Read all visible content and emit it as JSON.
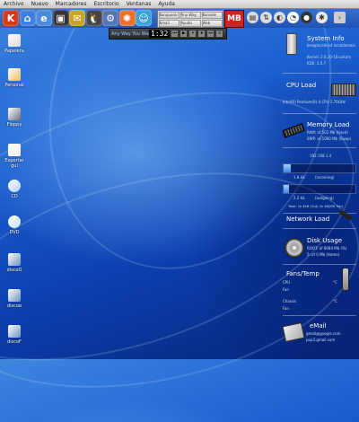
{
  "menubar": {
    "items": [
      "Archivo",
      "Nuevo",
      "Marcadores",
      "Escritorio",
      "Ventanas",
      "Ayuda"
    ]
  },
  "panel": {
    "launchers": [
      {
        "icon": "k-icon",
        "glyph": "K",
        "color": "#d23a1e"
      },
      {
        "icon": "home-icon",
        "glyph": "⌂",
        "color": "#3f7fe0"
      },
      {
        "icon": "konqueror-icon",
        "glyph": "e",
        "color": "#4a8ad8"
      },
      {
        "icon": "terminal-icon",
        "glyph": "▣",
        "color": "#333333"
      },
      {
        "icon": "mail-icon",
        "glyph": "✉",
        "color": "#c9a227"
      },
      {
        "icon": "tux-icon",
        "glyph": "🐧",
        "color": "#444444"
      },
      {
        "icon": "settings-icon",
        "glyph": "⚙",
        "color": "#5573b8"
      },
      {
        "icon": "firefox-icon",
        "glyph": "✺",
        "color": "#e8702a"
      },
      {
        "icon": "chat-icon",
        "glyph": "☺",
        "color": "#3aa0d8"
      }
    ],
    "task_buttons": [
      "Konqueror",
      "Any Way",
      "Konsole",
      "Kmail",
      "Ayuda",
      "Web"
    ],
    "tray_label": "MB"
  },
  "player": {
    "title": "Any Way You Wan",
    "time": "1:32",
    "buttons": [
      "⏮",
      "▶",
      "⏸",
      "⏹",
      "⏭",
      "x"
    ]
  },
  "desktop_icons": [
    {
      "label": "Papelera",
      "icon": "trash-icon",
      "color": "#d8d8e0"
    },
    {
      "label": "Personal",
      "icon": "home-folder-icon",
      "color": "#e8c060"
    },
    {
      "label": "Floppy",
      "icon": "floppy-icon",
      "color": "#6a7080"
    },
    {
      "label": "Exportar\ngui",
      "icon": "document-icon",
      "color": "#f0f0f0"
    },
    {
      "label": "CD",
      "icon": "cd-icon",
      "color": "#b0d0ff"
    },
    {
      "label": "DVD",
      "icon": "dvd-icon",
      "color": "#c0e0ff"
    },
    {
      "label": "discoO",
      "icon": "disk-icon",
      "color": "#7090c0"
    },
    {
      "label": "discoe",
      "icon": "disk-icon",
      "color": "#7090c0"
    },
    {
      "label": "discoF",
      "icon": "disk-icon",
      "color": "#7090c0"
    }
  ],
  "sysinfo": {
    "system_title": "System Info",
    "system_sub": "bro@localhost localdomain",
    "kernel": "Kernel: 2.6.20-16custom",
    "kde": "KDE: 3.5.7",
    "cpu_title": "CPU Load",
    "cpu_model": "Intel(R) Pentium(R) 4 CPU 1.70GHz",
    "cpu_load_pct": 20,
    "memory_title": "Memory Load",
    "memory_ram": "RAM:    of 502 Mb (Used)",
    "memory_swap": "SWP:    of 1000 Mb (Swap)",
    "net_ip": "192.168.1.4",
    "net_down": "1.8 kb",
    "net_down_label": "(incoming)",
    "net_up": "2.2 kb",
    "net_up_label": "(outgoing)",
    "net_total": "Total: 1k 4kB (Out)    2k 4B(MB 7kb)",
    "net_title": "Network Load",
    "disk_title": "Disk Usage",
    "disk_root": "ROOT:    of 8084 Mb (%)",
    "disk_home": "5:      of 0 Mb (Home)",
    "fans_title": "Fans/Temp",
    "fan_cpu_label": "CPU",
    "fan_cpu_val": "°C",
    "fan_fan_label": "Fan",
    "fan_chassis_label": "Chassis",
    "fan_chassis_val": "°C",
    "fan2_label": "Fan",
    "email_title": "eMail",
    "email_1": "gmail@google.com",
    "email_2": "pop3.gmail.com"
  }
}
